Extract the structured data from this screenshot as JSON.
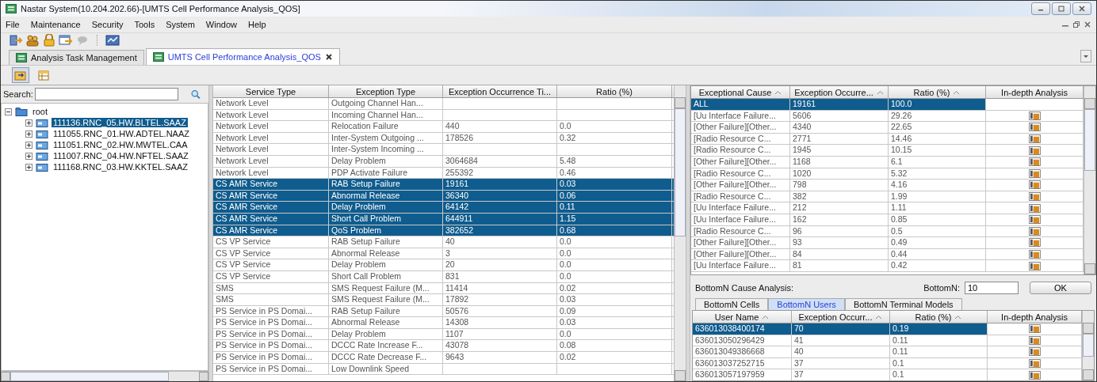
{
  "window": {
    "title": "Nastar System(10.204.202.66)-[UMTS Cell Performance Analysis_QOS]"
  },
  "menu": [
    "File",
    "Maintenance",
    "Security",
    "Tools",
    "System",
    "Window",
    "Help"
  ],
  "tabs": [
    {
      "label": "Analysis Task Management",
      "selected": false,
      "closable": false
    },
    {
      "label": "UMTS Cell Performance Analysis_QOS",
      "selected": true,
      "closable": true
    }
  ],
  "search": {
    "label": "Search:"
  },
  "tree": {
    "label": "root",
    "expanded": true,
    "children": [
      {
        "label": "111136.RNC_05.HW.BLTEL.SAAZ",
        "selected": true,
        "expanded": false
      },
      {
        "label": "111055.RNC_01.HW.ADTEL.NAAZ",
        "selected": false,
        "expanded": false
      },
      {
        "label": "111051.RNC_02.HW.MWTEL.CAA",
        "selected": false,
        "expanded": false
      },
      {
        "label": "111007.RNC_04.HW.NFTEL.SAAZ",
        "selected": false,
        "expanded": false
      },
      {
        "label": "111168.RNC_03.HW.KKTEL.SAAZ",
        "selected": false,
        "expanded": false
      }
    ]
  },
  "service_table": {
    "columns": [
      "Service Type",
      "Exception Type",
      "Exception Occurrence Ti...",
      "Ratio (%)"
    ],
    "rows": [
      {
        "service": "Network Level",
        "exception": "Outgoing Channel Han...",
        "selected": false
      },
      {
        "service": "Network Level",
        "exception": "Incoming Channel Han...",
        "selected": false
      },
      {
        "service": "Network Level",
        "exception": "Relocation Failure",
        "count": "440",
        "ratio": "0.0",
        "selected": false
      },
      {
        "service": "Network Level",
        "exception": "Inter-System Outgoing ...",
        "count": "178526",
        "ratio": "0.32",
        "selected": false
      },
      {
        "service": "Network Level",
        "exception": "Inter-System Incoming ...",
        "selected": false
      },
      {
        "service": "Network Level",
        "exception": "Delay Problem",
        "count": "3064684",
        "ratio": "5.48",
        "selected": false
      },
      {
        "service": "Network Level",
        "exception": "PDP Activate Failure",
        "count": "255392",
        "ratio": "0.46",
        "selected": false
      },
      {
        "service": "CS AMR Service",
        "exception": "RAB Setup Failure",
        "count": "19161",
        "ratio": "0.03",
        "selected": true
      },
      {
        "service": "CS AMR Service",
        "exception": "Abnormal Release",
        "count": "36340",
        "ratio": "0.06",
        "selected": true
      },
      {
        "service": "CS AMR Service",
        "exception": "Delay Problem",
        "count": "64142",
        "ratio": "0.11",
        "selected": true
      },
      {
        "service": "CS AMR Service",
        "exception": "Short Call Problem",
        "count": "644911",
        "ratio": "1.15",
        "selected": true
      },
      {
        "service": "CS AMR Service",
        "exception": "QoS Problem",
        "count": "382652",
        "ratio": "0.68",
        "selected": true
      },
      {
        "service": "CS VP Service",
        "exception": "RAB Setup Failure",
        "count": "40",
        "ratio": "0.0",
        "selected": false
      },
      {
        "service": "CS VP Service",
        "exception": "Abnormal Release",
        "count": "3",
        "ratio": "0.0",
        "selected": false
      },
      {
        "service": "CS VP Service",
        "exception": "Delay Problem",
        "count": "20",
        "ratio": "0.0",
        "selected": false
      },
      {
        "service": "CS VP Service",
        "exception": "Short Call Problem",
        "count": "831",
        "ratio": "0.0",
        "selected": false
      },
      {
        "service": "SMS",
        "exception": "SMS Request Failure (M...",
        "count": "11414",
        "ratio": "0.02",
        "selected": false
      },
      {
        "service": "SMS",
        "exception": "SMS Request Failure (M...",
        "count": "17892",
        "ratio": "0.03",
        "selected": false
      },
      {
        "service": "PS Service in PS Domai...",
        "exception": "RAB Setup Failure",
        "count": "50576",
        "ratio": "0.09",
        "selected": false
      },
      {
        "service": "PS Service in PS Domai...",
        "exception": "Abnormal Release",
        "count": "14308",
        "ratio": "0.03",
        "selected": false
      },
      {
        "service": "PS Service in PS Domai...",
        "exception": "Delay Problem",
        "count": "1107",
        "ratio": "0.0",
        "selected": false
      },
      {
        "service": "PS Service in PS Domai...",
        "exception": "DCCC Rate Increase F...",
        "count": "43078",
        "ratio": "0.08",
        "selected": false
      },
      {
        "service": "PS Service in PS Domai...",
        "exception": "DCCC Rate Decrease F...",
        "count": "9643",
        "ratio": "0.02",
        "selected": false
      },
      {
        "service": "PS Service in PS Domai...",
        "exception": "Low Downlink Speed",
        "selected": false
      }
    ]
  },
  "cause_table": {
    "columns": [
      {
        "label": "Exceptional Cause",
        "sorted": true
      },
      {
        "label": "Exception Occurre...",
        "sorted": true
      },
      {
        "label": "Ratio (%)",
        "sorted": true
      },
      {
        "label": "In-depth Analysis",
        "sorted": false
      }
    ],
    "rows": [
      {
        "name": "ALL",
        "count": "19161",
        "ratio": "100.0",
        "selected": true,
        "analysis": false
      },
      {
        "name": "[Uu Interface Failure...",
        "count": "5606",
        "ratio": "29.26",
        "selected": false,
        "analysis": true
      },
      {
        "name": "[Other Failure][Other...",
        "count": "4340",
        "ratio": "22.65",
        "selected": false,
        "analysis": true
      },
      {
        "name": "[Radio Resource C...",
        "count": "2771",
        "ratio": "14.46",
        "selected": false,
        "analysis": true
      },
      {
        "name": "[Radio Resource C...",
        "count": "1945",
        "ratio": "10.15",
        "selected": false,
        "analysis": true
      },
      {
        "name": "[Other Failure][Other...",
        "count": "1168",
        "ratio": "6.1",
        "selected": false,
        "analysis": true
      },
      {
        "name": "[Radio Resource C...",
        "count": "1020",
        "ratio": "5.32",
        "selected": false,
        "analysis": true
      },
      {
        "name": "[Other Failure][Other...",
        "count": "798",
        "ratio": "4.16",
        "selected": false,
        "analysis": true
      },
      {
        "name": "[Radio Resource C...",
        "count": "382",
        "ratio": "1.99",
        "selected": false,
        "analysis": true
      },
      {
        "name": "[Uu Interface Failure...",
        "count": "212",
        "ratio": "1.11",
        "selected": false,
        "analysis": true
      },
      {
        "name": "[Uu Interface Failure...",
        "count": "162",
        "ratio": "0.85",
        "selected": false,
        "analysis": true
      },
      {
        "name": "[Radio Resource C...",
        "count": "96",
        "ratio": "0.5",
        "selected": false,
        "analysis": true
      },
      {
        "name": "[Other Failure][Other...",
        "count": "93",
        "ratio": "0.49",
        "selected": false,
        "analysis": true
      },
      {
        "name": "[Other Failure][Other...",
        "count": "84",
        "ratio": "0.44",
        "selected": false,
        "analysis": true
      },
      {
        "name": "[Uu Interface Failure...",
        "count": "81",
        "ratio": "0.42",
        "selected": false,
        "analysis": true
      }
    ]
  },
  "bottomn": {
    "title": "BottomN Cause Analysis:",
    "field_label": "BottomN:",
    "value": "10",
    "button": "OK",
    "tabs": [
      {
        "label": "BottomN Cells",
        "selected": false
      },
      {
        "label": "BottomN Users",
        "selected": true
      },
      {
        "label": "BottomN Terminal Models",
        "selected": false
      }
    ],
    "columns": [
      {
        "label": "User Name",
        "sorted": true
      },
      {
        "label": "Exception Occurr...",
        "sorted": true
      },
      {
        "label": "Ratio (%)",
        "sorted": true
      },
      {
        "label": "In-depth Analysis",
        "sorted": false
      }
    ],
    "rows": [
      {
        "name": "636013038400174",
        "count": "70",
        "ratio": "0.19",
        "selected": true,
        "analysis": true
      },
      {
        "name": "636013050296429",
        "count": "41",
        "ratio": "0.11",
        "selected": false,
        "analysis": true
      },
      {
        "name": "636013049386668",
        "count": "40",
        "ratio": "0.11",
        "selected": false,
        "analysis": true
      },
      {
        "name": "636013037252715",
        "count": "37",
        "ratio": "0.1",
        "selected": false,
        "analysis": true
      },
      {
        "name": "636013057197959",
        "count": "37",
        "ratio": "0.1",
        "selected": false,
        "analysis": true
      }
    ]
  }
}
